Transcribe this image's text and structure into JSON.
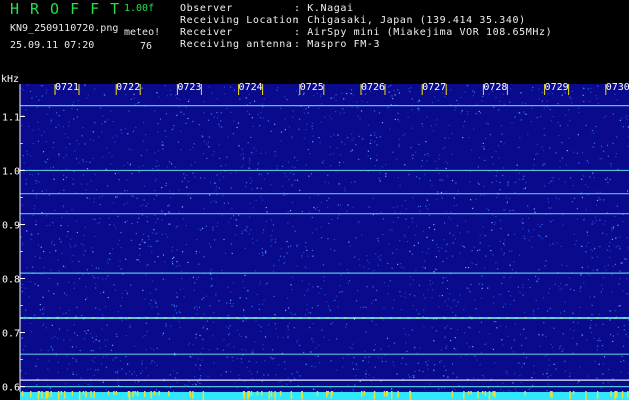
{
  "header": {
    "title": "HROFFT",
    "version": "1.00f",
    "filename": "KN9_2509110720.png",
    "datetime": "25.09.11 07:20",
    "meteor_label": "meteo!",
    "meteor_count": "76"
  },
  "meta": [
    {
      "key": "Observer",
      "value": ": K.Nagai"
    },
    {
      "key": "Receiving Location",
      "value": ": Chigasaki, Japan (139.414 35.340)"
    },
    {
      "key": "Receiver",
      "value": ": AirSpy mini (Miakejima VOR 108.65MHz)"
    },
    {
      "key": "Receiving antenna",
      "value": ": Maspro FM-3"
    }
  ],
  "chart_data": {
    "type": "heatmap",
    "ylabel": "kHz",
    "yticks": [
      "1.1",
      "1.0",
      "0.9",
      "0.8",
      "0.7",
      "0.6"
    ],
    "xticks": [
      "0721",
      "0722",
      "0723",
      "0724",
      "0725",
      "0726",
      "0727",
      "0728",
      "0729",
      "0730"
    ],
    "ylim": [
      0.59,
      1.16
    ],
    "carrier_lines_khz": [
      1.12,
      1.0,
      0.957,
      0.92,
      0.81,
      0.727,
      0.66,
      0.612,
      0.6
    ]
  },
  "colors": {
    "background": "#0a0a8c",
    "line": "#5fd6e8",
    "accent": "#22e04a",
    "bottom_bar": "#2fe8ff"
  }
}
